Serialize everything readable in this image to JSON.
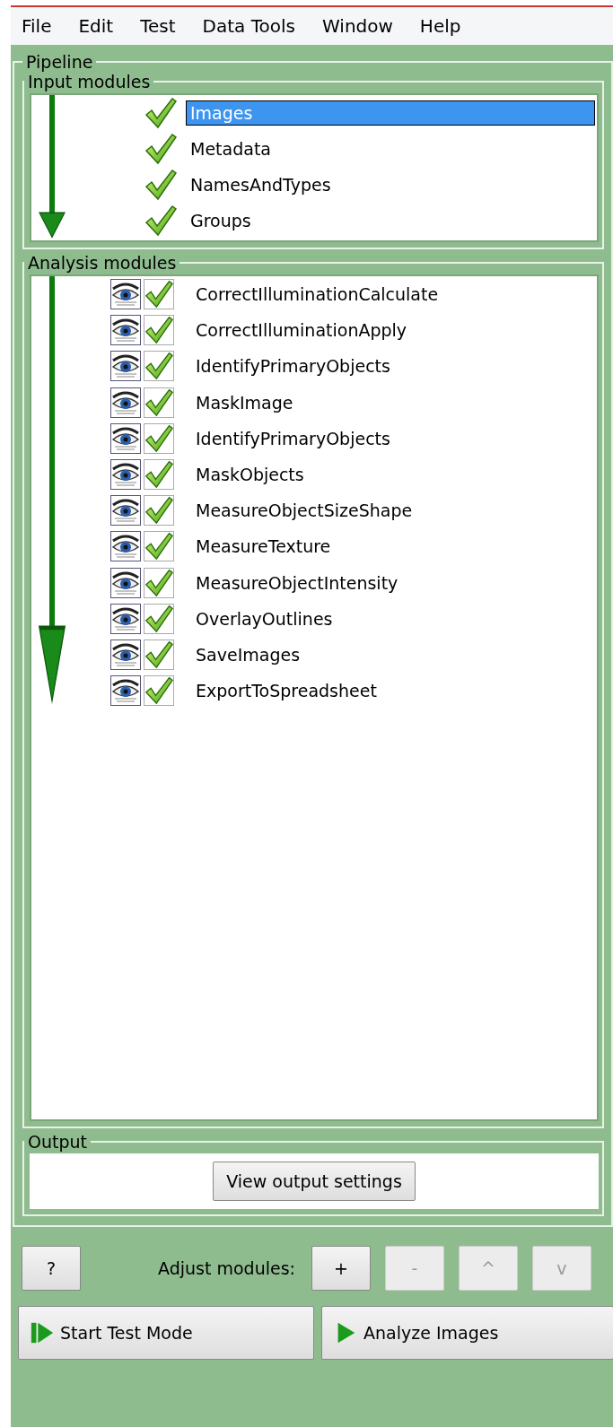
{
  "menu": [
    "File",
    "Edit",
    "Test",
    "Data Tools",
    "Window",
    "Help"
  ],
  "pipeline": {
    "title": "Pipeline",
    "input_modules": {
      "title": "Input modules",
      "items": [
        {
          "name": "Images",
          "enabled": true,
          "selected": true
        },
        {
          "name": "Metadata",
          "enabled": true,
          "selected": false
        },
        {
          "name": "NamesAndTypes",
          "enabled": true,
          "selected": false
        },
        {
          "name": "Groups",
          "enabled": true,
          "selected": false
        }
      ]
    },
    "analysis_modules": {
      "title": "Analysis modules",
      "items": [
        {
          "name": "CorrectIlluminationCalculate",
          "show_display": true,
          "enabled": true,
          "selected": false
        },
        {
          "name": "CorrectIlluminationApply",
          "show_display": true,
          "enabled": true,
          "selected": false
        },
        {
          "name": "IdentifyPrimaryObjects",
          "show_display": true,
          "enabled": true,
          "selected": false
        },
        {
          "name": "MaskImage",
          "show_display": true,
          "enabled": true,
          "selected": false
        },
        {
          "name": "IdentifyPrimaryObjects",
          "show_display": true,
          "enabled": true,
          "selected": false
        },
        {
          "name": "MaskObjects",
          "show_display": true,
          "enabled": true,
          "selected": false
        },
        {
          "name": "MeasureObjectSizeShape",
          "show_display": true,
          "enabled": true,
          "selected": false
        },
        {
          "name": "MeasureTexture",
          "show_display": true,
          "enabled": true,
          "selected": false
        },
        {
          "name": "MeasureObjectIntensity",
          "show_display": true,
          "enabled": true,
          "selected": false
        },
        {
          "name": "OverlayOutlines",
          "show_display": true,
          "enabled": true,
          "selected": false
        },
        {
          "name": "SaveImages",
          "show_display": true,
          "enabled": true,
          "selected": false
        },
        {
          "name": "ExportToSpreadsheet",
          "show_display": true,
          "enabled": true,
          "selected": false
        }
      ]
    },
    "output": {
      "title": "Output",
      "button": "View output settings"
    }
  },
  "help_button": "?",
  "adjust_label": "Adjust modules:",
  "adjust_buttons": [
    {
      "label": "+",
      "disabled": false
    },
    {
      "label": "-",
      "disabled": true
    },
    {
      "label": "^",
      "disabled": true
    },
    {
      "label": "v",
      "disabled": true
    }
  ],
  "actions": [
    {
      "label": "Start Test Mode",
      "kind": "test"
    },
    {
      "label": "Analyze Images",
      "kind": "analyze"
    }
  ]
}
